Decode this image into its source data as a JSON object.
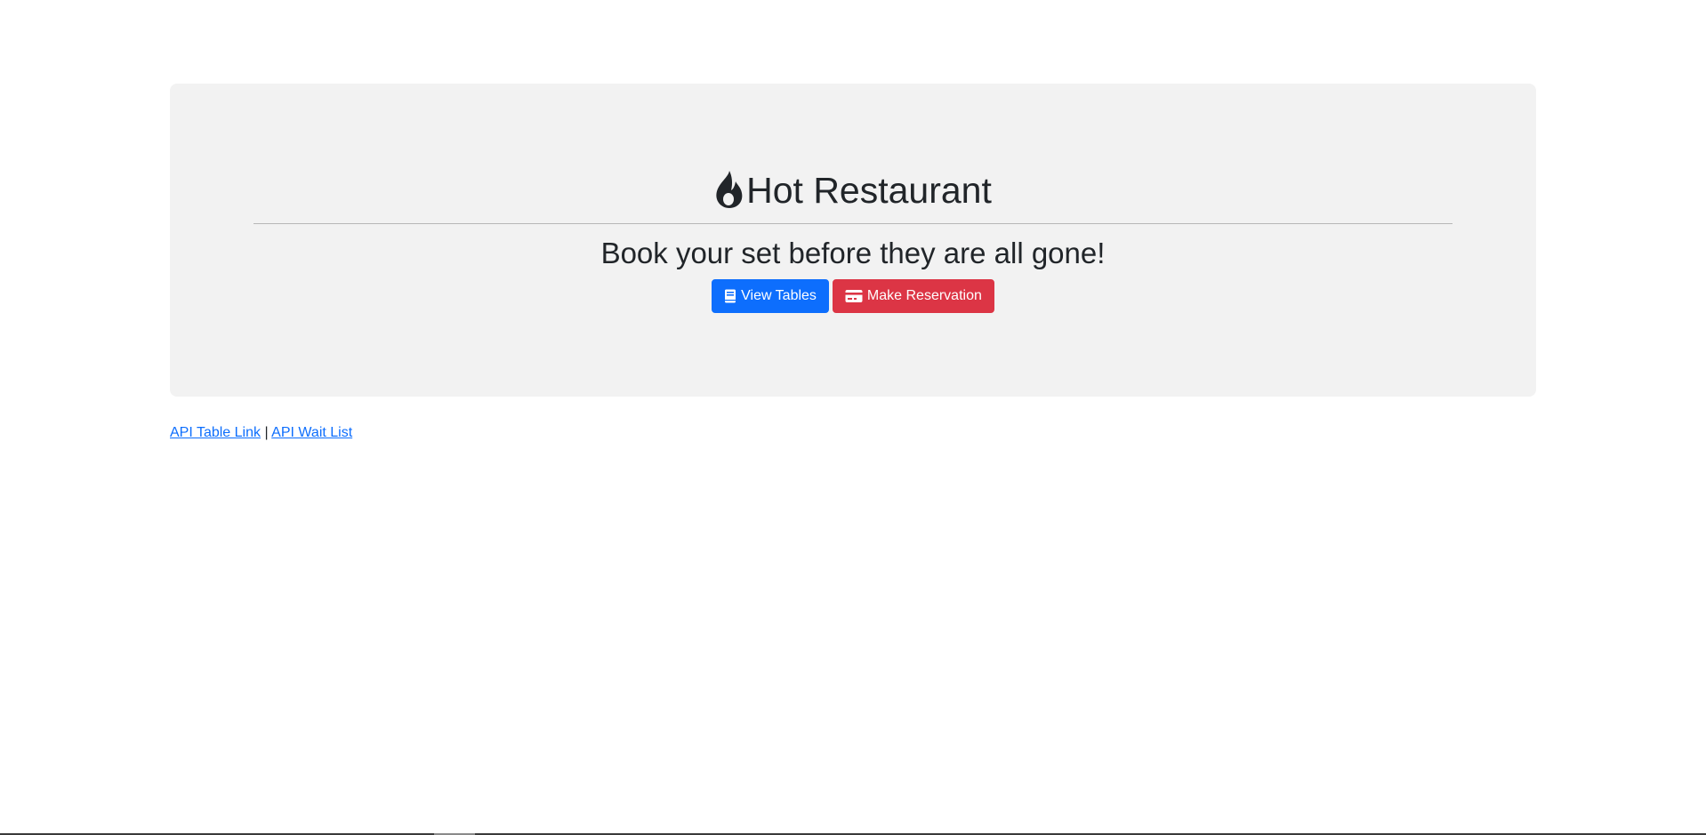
{
  "header": {
    "title": "Hot Restaurant",
    "title_icon": "flame-icon",
    "subtitle": "Book your set before they are all gone!"
  },
  "actions": {
    "view_tables": {
      "label": "View Tables",
      "icon": "book-icon",
      "color": "#0d6efd"
    },
    "make_reservation": {
      "label": "Make Reservation",
      "icon": "credit-card-icon",
      "color": "#dc3545"
    }
  },
  "footer_links": {
    "api_table": "API Table Link",
    "separator": "|",
    "api_wait_list": "API Wait List"
  },
  "colors": {
    "jumbotron_bg": "#f2f2f2",
    "link": "#0d6efd",
    "text": "#212529"
  }
}
